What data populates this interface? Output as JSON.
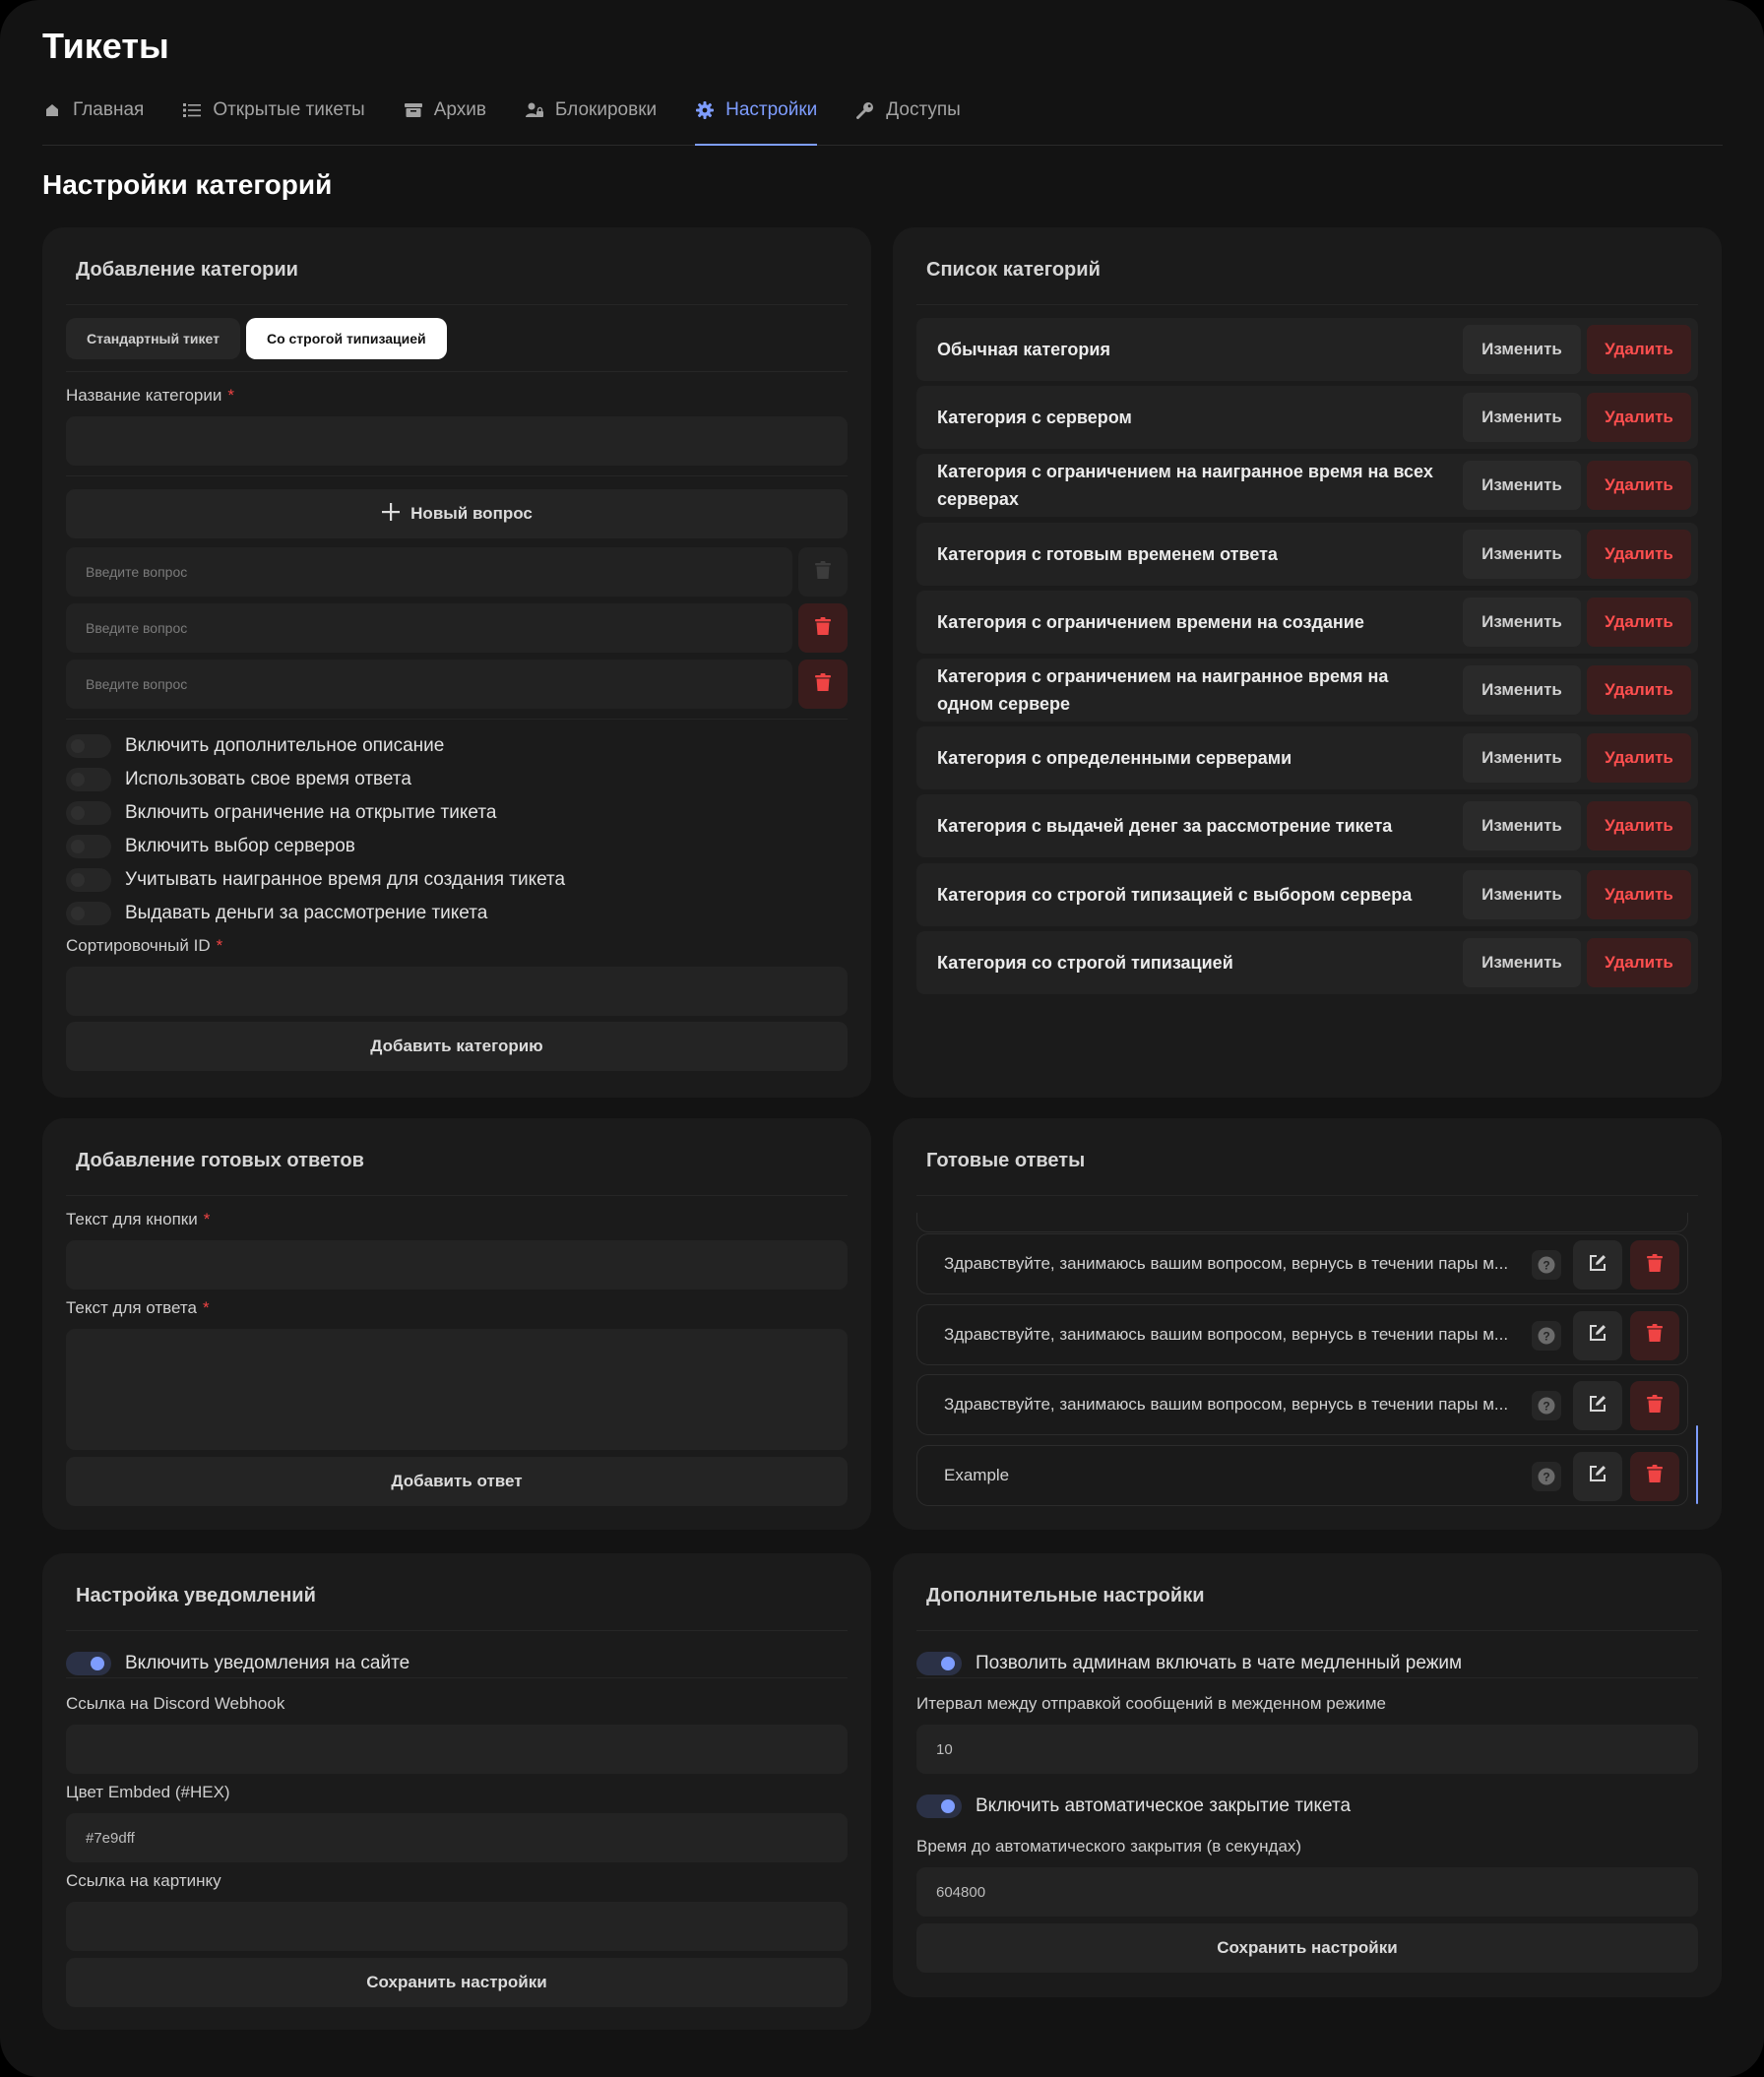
{
  "app": {
    "title": "Тикеты"
  },
  "nav": {
    "items": [
      {
        "label": "Главная",
        "icon": "home-icon"
      },
      {
        "label": "Открытые тикеты",
        "icon": "list-icon"
      },
      {
        "label": "Архив",
        "icon": "archive-icon"
      },
      {
        "label": "Блокировки",
        "icon": "user-lock-icon"
      },
      {
        "label": "Настройки",
        "icon": "gear-icon",
        "active": true
      },
      {
        "label": "Доступы",
        "icon": "key-icon"
      }
    ]
  },
  "page": {
    "title": "Настройки категорий"
  },
  "add_category": {
    "title": "Добавление категории",
    "type_standard": "Стандартный тикет",
    "type_strict": "Со строгой типизацией",
    "name_label": "Название категории",
    "required_mark": "*",
    "name_value": "",
    "new_question": "Новый вопрос",
    "question_placeholders": [
      "Введите вопрос",
      "Введите вопрос",
      "Введите вопрос"
    ],
    "toggles": [
      {
        "label": "Включить дополнительное описание",
        "on": false
      },
      {
        "label": "Использовать свое время ответа",
        "on": false
      },
      {
        "label": "Включить ограничение на открытие тикета",
        "on": false
      },
      {
        "label": "Включить выбор серверов",
        "on": false
      },
      {
        "label": "Учитывать наигранное время для создания тикета",
        "on": false
      },
      {
        "label": "Выдавать деньги за рассмотрение тикета",
        "on": false
      }
    ],
    "sort_label": "Сортировочный ID",
    "sort_value": "",
    "submit": "Добавить категорию"
  },
  "category_list": {
    "title": "Список категорий",
    "edit_label": "Изменить",
    "delete_label": "Удалить",
    "items": [
      "Обычная категория",
      "Категория с сервером",
      "Категория с ограничением на наигранное время на всех серверах",
      "Категория с готовым временем ответа",
      "Категория с ограничением времени на создание",
      "Категория с ограничением на наигранное время на одном сервере",
      "Категория с определенными серверами",
      "Категория с выдачей денег за рассмотрение тикета",
      "Категория со строгой типизацией с выбором сервера",
      "Категория со строгой типизацией"
    ]
  },
  "add_answer": {
    "title": "Добавление готовых ответов",
    "button_text_label": "Текст для кнопки",
    "answer_text_label": "Текст для ответа",
    "required_mark": "*",
    "submit": "Добавить ответ"
  },
  "answers": {
    "title": "Готовые ответы",
    "items": [
      "Здравствуйте, занимаюсь вашим вопросом, вернусь в течении пары м...",
      "Здравствуйте, занимаюсь вашим вопросом, вернусь в течении пары м...",
      "Здравствуйте, занимаюсь вашим вопросом, вернусь в течении пары м...",
      "Example"
    ]
  },
  "notifications": {
    "title": "Настройка уведомлений",
    "enable_label": "Включить уведомления на сайте",
    "enable_on": true,
    "webhook_label": "Ссылка на Discord Webhook",
    "webhook_value": "",
    "color_label": "Цвет Embded (#HEX)",
    "color_value": "#7e9dff",
    "image_label": "Ссылка на картинку",
    "image_value": "",
    "submit": "Сохранить настройки"
  },
  "extra": {
    "title": "Дополнительные настройки",
    "slowmode_label": "Позволить админам включать в чате медленный режим",
    "slowmode_on": true,
    "interval_label": "Итервал между отправкой сообщений в межденном режиме",
    "interval_value": "10",
    "autoclose_label": "Включить автоматическое закрытие тикета",
    "autoclose_on": true,
    "autoclose_time_label": "Время до автоматического закрытия (в секундах)",
    "autoclose_time_value": "604800",
    "submit": "Сохранить настройки"
  },
  "colors": {
    "accent": "#7e9dff",
    "danger": "#ef4444",
    "background": "#131313",
    "card": "#1b1b1b"
  }
}
